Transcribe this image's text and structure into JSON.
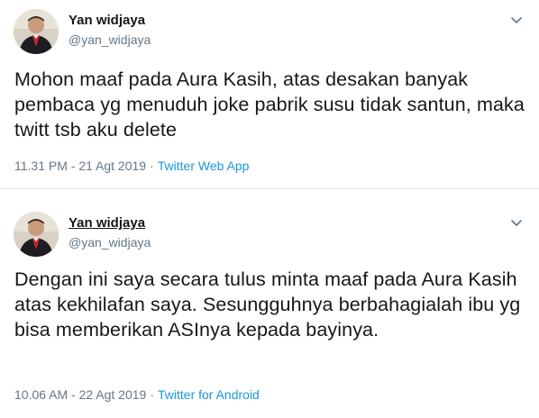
{
  "tweets": [
    {
      "author_name": "Yan widjaya",
      "author_handle": "@yan_widjaya",
      "text": "Mohon maaf pada Aura Kasih, atas desakan banyak pembaca yg menuduh joke pabrik susu tidak santun, maka twitt tsb aku delete",
      "timestamp": "11.31 PM - 21 Agt 2019",
      "separator": "·",
      "source": "Twitter Web App"
    },
    {
      "author_name": "Yan widjaya",
      "author_handle": "@yan_widjaya",
      "text": "Dengan ini saya secara tulus minta maaf pada Aura Kasih atas kekhilafan saya. Sesungguhnya berbahagialah ibu yg bisa memberikan ASInya kepada bayinya.",
      "timestamp": "10.06 AM - 22 Agt 2019",
      "separator": "·",
      "source": "Twitter for Android"
    }
  ],
  "colors": {
    "text": "#14171a",
    "secondary": "#657786",
    "link": "#1b95e0",
    "divider": "#e6ecf0"
  },
  "icons": {
    "caret": "chevron-down-icon",
    "avatar": "avatar"
  }
}
